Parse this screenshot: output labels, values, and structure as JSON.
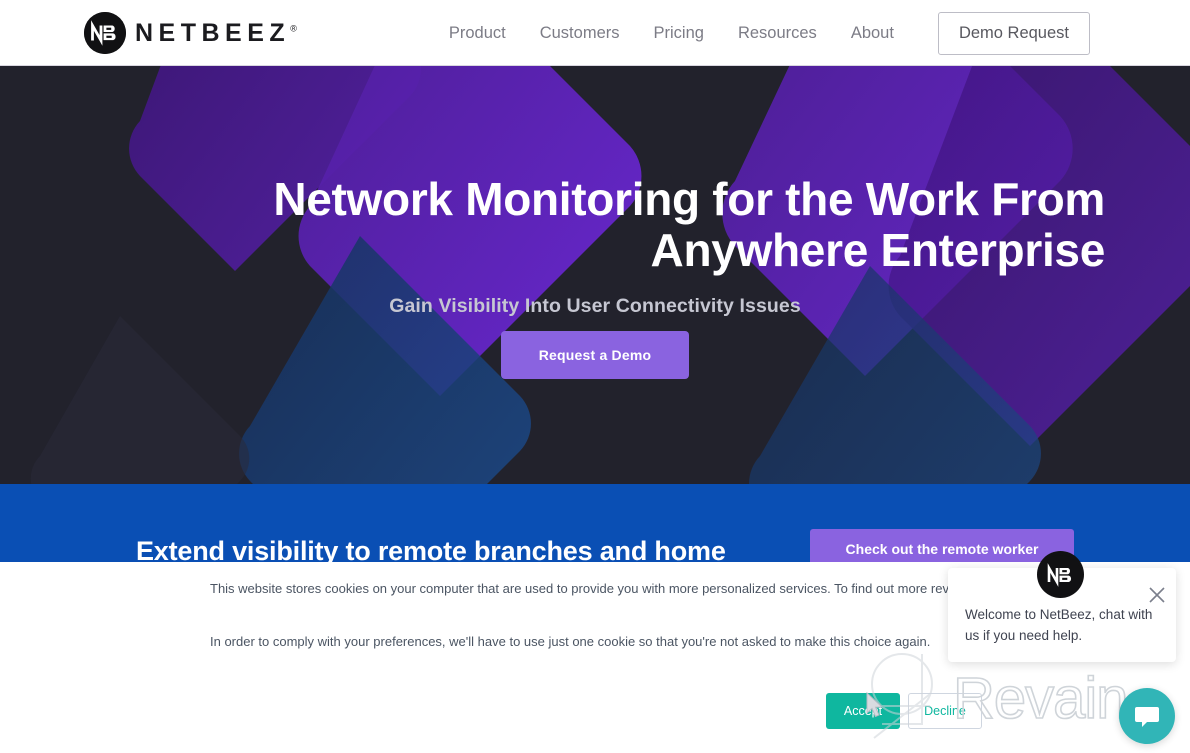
{
  "header": {
    "logo": {
      "mark_text": "NB",
      "word": "NETBEEZ",
      "trademark": "®",
      "icon": "netbeez-logo-icon"
    },
    "nav_items": [
      {
        "label": "Product"
      },
      {
        "label": "Customers"
      },
      {
        "label": "Pricing"
      },
      {
        "label": "Resources"
      },
      {
        "label": "About"
      }
    ],
    "demo_request_label": "Demo Request"
  },
  "hero": {
    "title": "Network Monitoring for the Work From Anywhere Enterprise",
    "subtitle": "Gain Visibility Into User Connectivity Issues",
    "cta_label": "Request a Demo",
    "background_color": "#22222c",
    "accent_purple": "#5b21b6",
    "accent_blue": "#1e3a6e",
    "cta_color": "#8a63e0"
  },
  "blue_section": {
    "heading": "Extend visibility to remote branches and home",
    "cta_label": "Check out the remote worker",
    "background_color": "#0a4fb4",
    "cta_color": "#8a63e0"
  },
  "cookie_banner": {
    "line_1": "This website stores cookies on your computer that are used to provide you with more personalized services. To find out more review our Privacy Pol",
    "line_2": "In order to comply with your preferences, we'll have to use just one cookie so that you're not asked to make this choice again.",
    "accept_label": "Accept",
    "decline_label": "Decline",
    "accept_color": "#0fb79f"
  },
  "chat_widget": {
    "avatar_text": "NB",
    "message": "Welcome to NetBeez, chat with us if you need help.",
    "close_icon": "close-icon",
    "bubble_icon": "chat-bubble-icon",
    "bubble_color": "#31b5b7"
  },
  "watermark": {
    "text": "Revain"
  }
}
